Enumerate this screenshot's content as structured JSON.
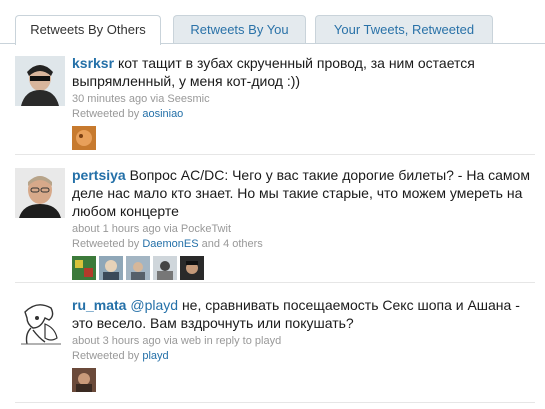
{
  "tabs": [
    {
      "label": "Retweets By Others",
      "active": true
    },
    {
      "label": "Retweets By You",
      "active": false
    },
    {
      "label": "Your Tweets, Retweeted",
      "active": false
    }
  ],
  "tweets": [
    {
      "user": "ksrksr",
      "text": "кот тащит в зубах скрученный провод, за ним остается выпрямленный, у меня кот-диод :))",
      "time": "30 minutes ago",
      "via_prefix": "via",
      "source": "Seesmic",
      "retweeted_by_prefix": "Retweeted by",
      "retweeted_by": "aosiniao",
      "others": ""
    },
    {
      "user": "pertsiya",
      "text": "Вопрос AC/DC: Чего у вас такие дорогие билеты? - На самом деле нас мало кто знает. Но мы такие старые, что можем умереть на любом концерте",
      "time": "about 1 hours ago",
      "via_prefix": "via",
      "source": "PockeTwit",
      "retweeted_by_prefix": "Retweeted by",
      "retweeted_by": "DaemonES",
      "others": "and 4 others"
    },
    {
      "user": "ru_mata",
      "mention": "@playd",
      "text": "не, сравнивать посещаемость Секс шопа и Ашана - это весело. Вам вздрочнуть или покушать?",
      "time": "about 3 hours ago",
      "via_prefix": "via",
      "source": "web",
      "reply_prefix": "in reply to",
      "reply_to": "playd",
      "retweeted_by_prefix": "Retweeted by",
      "retweeted_by": "playd",
      "others": ""
    }
  ],
  "colors": {
    "link": "#2470a8",
    "meta": "#999999",
    "tab_inactive_bg": "#e4eaee",
    "border": "#c9d3da"
  }
}
